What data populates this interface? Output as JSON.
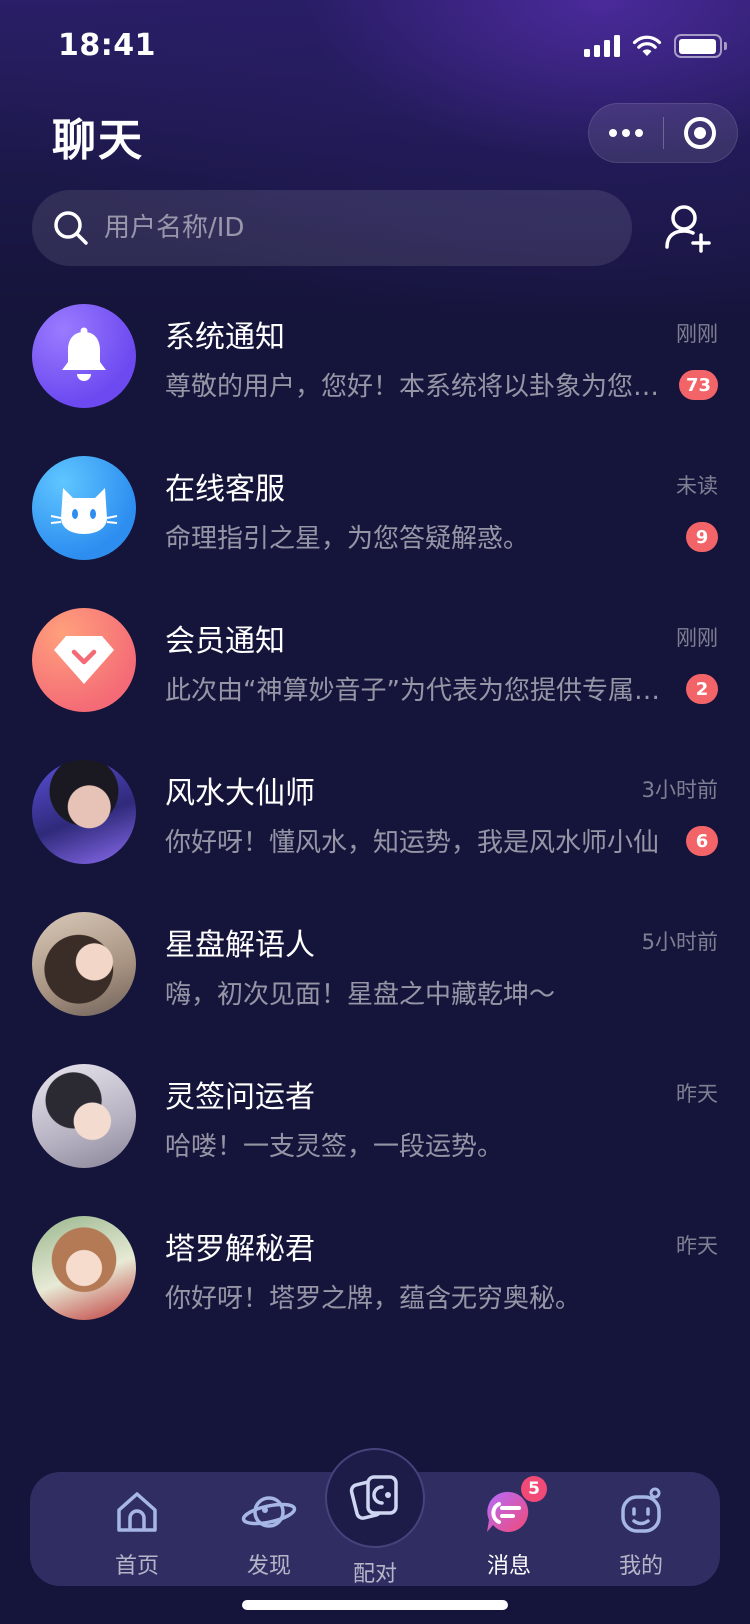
{
  "status_bar": {
    "time": "18:41",
    "battery_level": 0.95
  },
  "header": {
    "title": "聊天"
  },
  "search": {
    "placeholder": "用户名称/ID"
  },
  "chats": [
    {
      "name": "系统通知",
      "time": "刚刚",
      "preview": "尊敬的用户，您好！本系统将以卦象为您解读",
      "badge": "73",
      "avatar": "bell-icon",
      "avatar_color": "#7a5cf6"
    },
    {
      "name": "在线客服",
      "time": "未读",
      "preview": "命理指引之星，为您答疑解惑。",
      "badge": "9",
      "avatar": "cat-icon",
      "avatar_color": "#3aa0f5"
    },
    {
      "name": "会员通知",
      "time": "刚刚",
      "preview": "此次由“神算妙音子”为代表为您提供专属服务",
      "badge": "2",
      "avatar": "vip-diamond-icon",
      "avatar_color": "#f7806f"
    },
    {
      "name": "风水大仙师",
      "time": "3小时前",
      "preview": "你好呀！懂风水，知运势，我是风水师小仙",
      "badge": "6",
      "avatar": "user-photo"
    },
    {
      "name": "星盘解语人",
      "time": "5小时前",
      "preview": "嗨，初次见面！星盘之中藏乾坤～",
      "badge": "",
      "avatar": "user-photo"
    },
    {
      "name": "灵签问运者",
      "time": "昨天",
      "preview": "哈喽！一支灵签，一段运势。",
      "badge": "",
      "avatar": "user-photo"
    },
    {
      "name": "塔罗解秘君",
      "time": "昨天",
      "preview": "你好呀！塔罗之牌，蕴含无穷奥秘。",
      "badge": "",
      "avatar": "user-photo"
    }
  ],
  "tab_bar": {
    "tabs": [
      {
        "label": "首页",
        "icon": "home-icon"
      },
      {
        "label": "发现",
        "icon": "planet-icon"
      },
      {
        "label": "配对",
        "icon": "match-icon"
      },
      {
        "label": "消息",
        "icon": "message-icon",
        "active": true,
        "badge": "5"
      },
      {
        "label": "我的",
        "icon": "profile-icon"
      }
    ]
  },
  "colors": {
    "background": "#15143a",
    "badge": "#f26468",
    "tab_bar": "#2f2d62",
    "accent": "#f14a76"
  }
}
